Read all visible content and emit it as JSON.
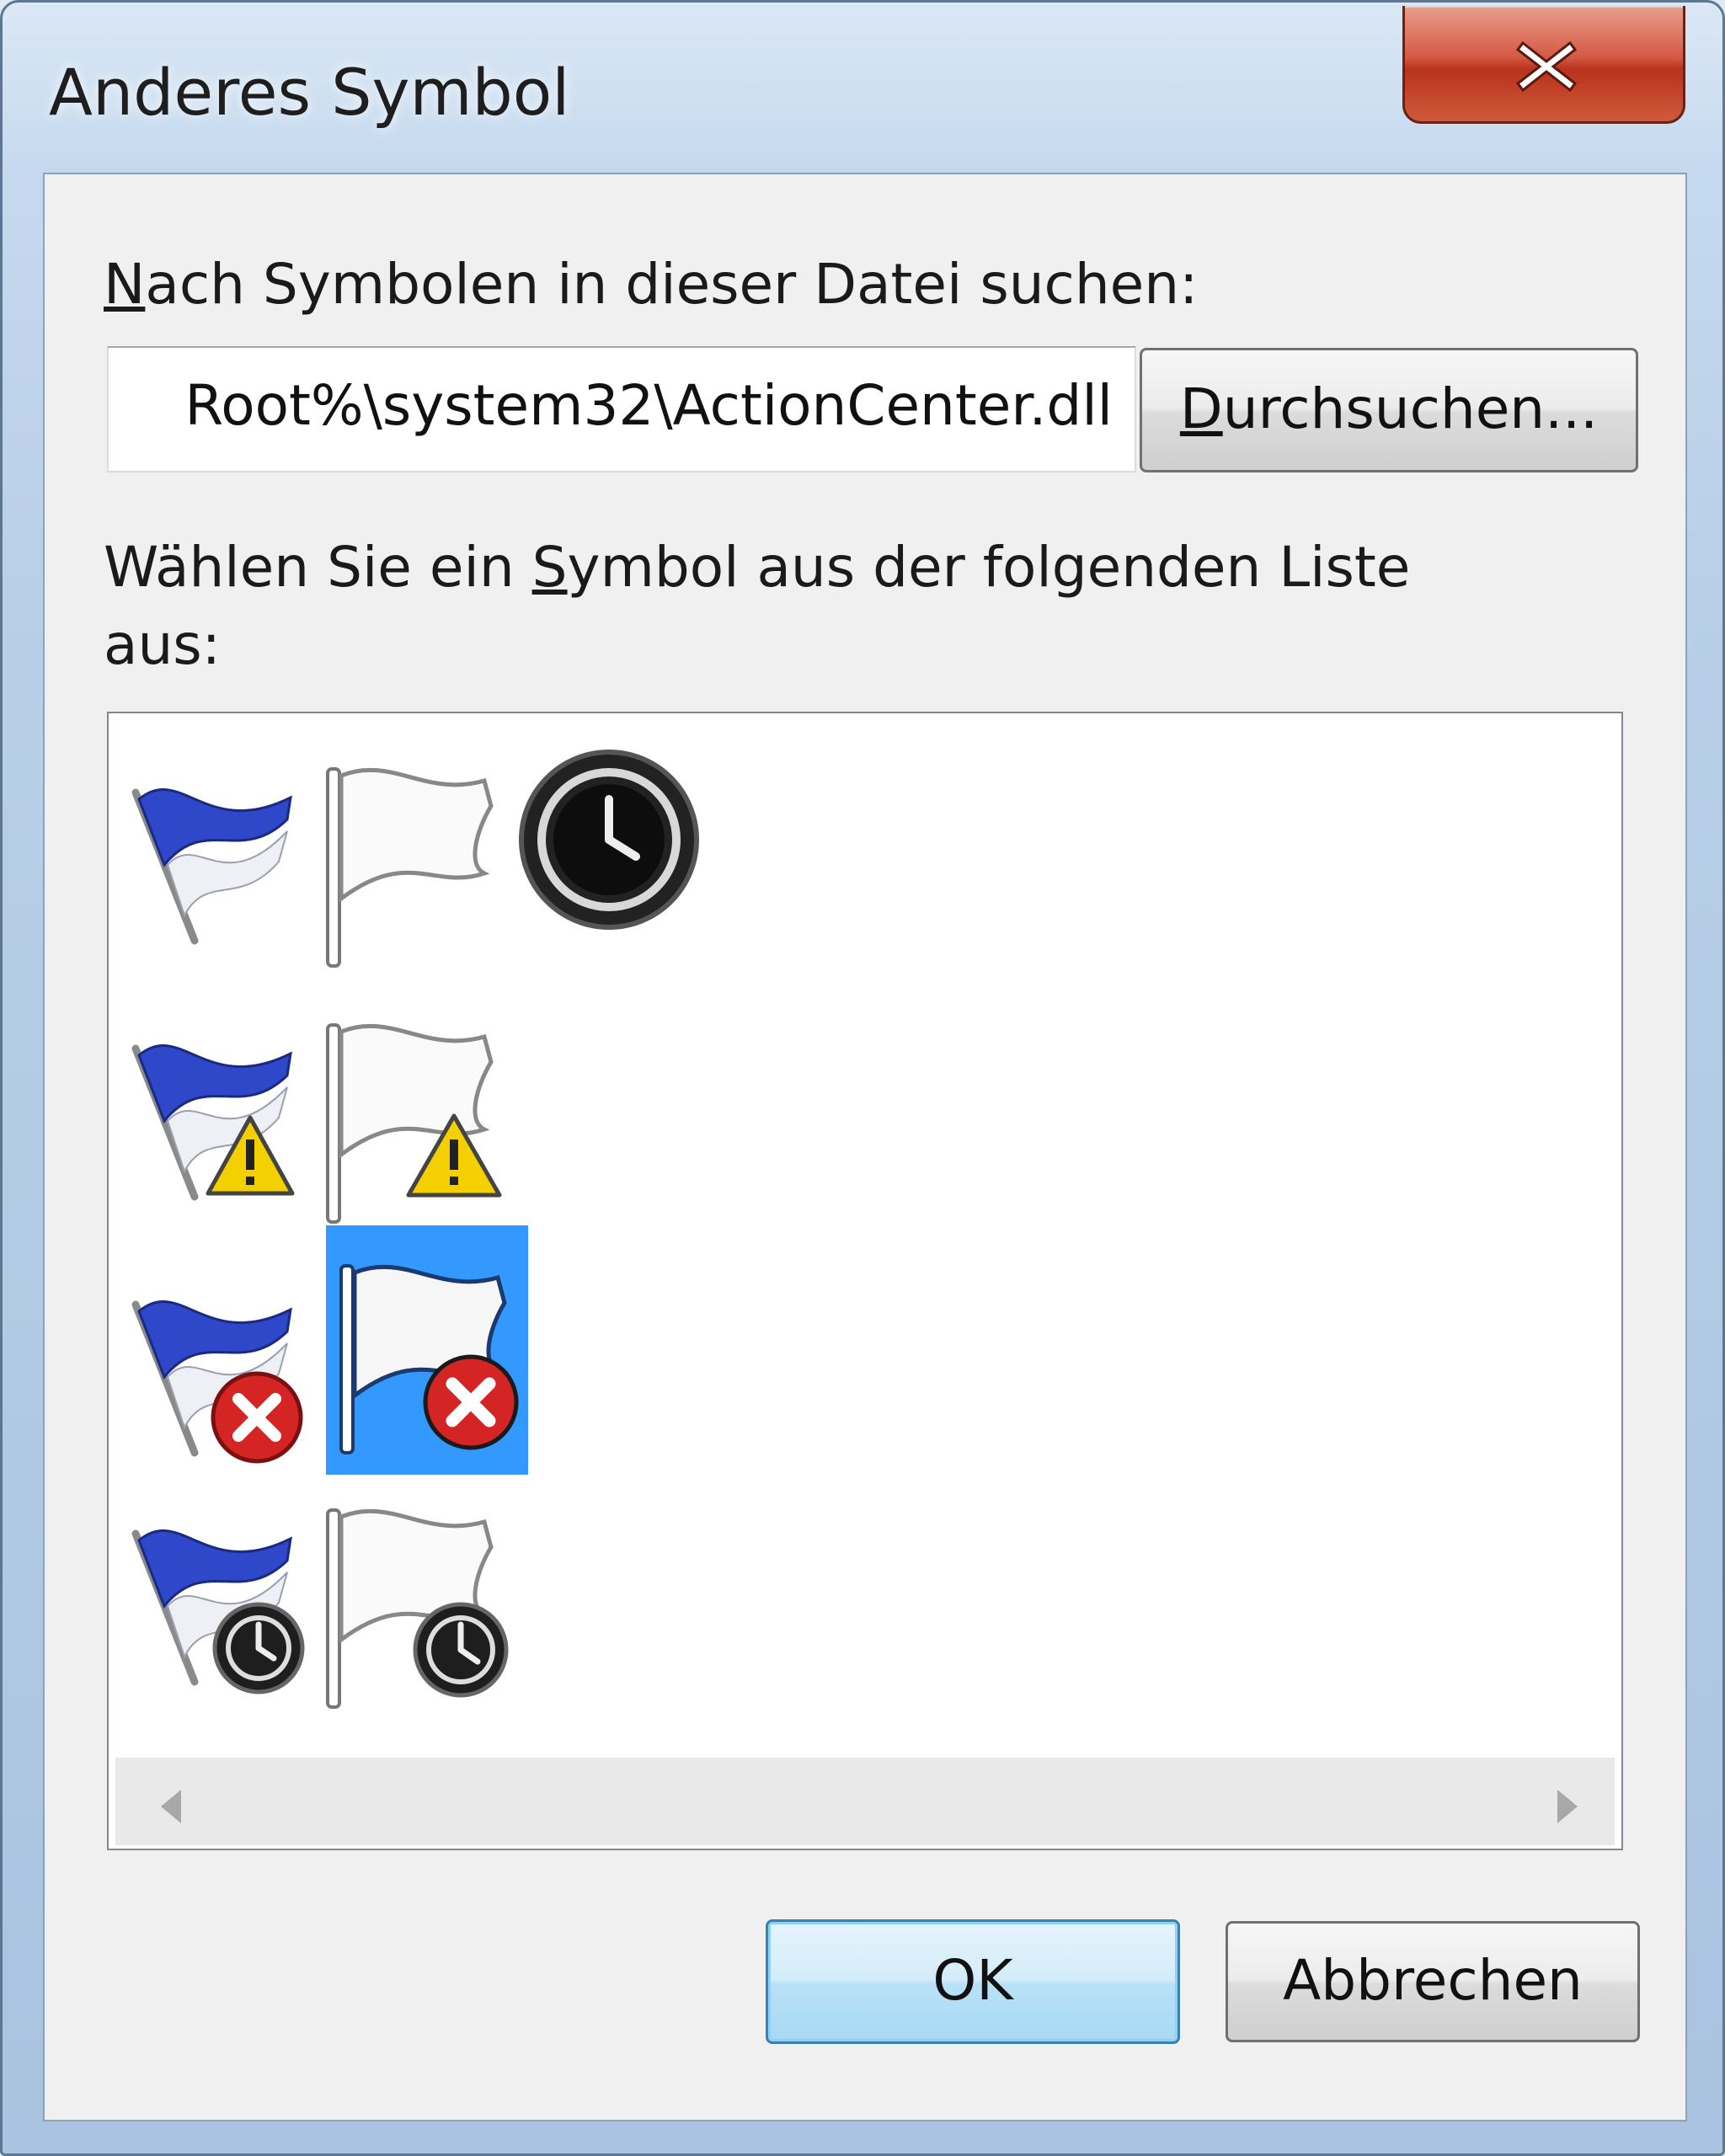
{
  "window": {
    "title": "Anderes Symbol"
  },
  "dialog": {
    "file_label_accel": "N",
    "file_label_rest": "ach Symbolen in dieser Datei suchen:",
    "file_path": "Root%\\system32\\ActionCenter.dll",
    "browse_accel": "D",
    "browse_rest": "urchsuchen...",
    "list_label_line1_pre": "Wählen Sie ein ",
    "list_label_line1_accel": "S",
    "list_label_line1_post": "ymbol aus der folgenden Liste",
    "list_label_line2": "aus:",
    "ok_label": "OK",
    "cancel_label": "Abbrechen"
  },
  "icons": [
    {
      "name": "blue-flag-icon",
      "selected": false
    },
    {
      "name": "white-flag-icon",
      "selected": false
    },
    {
      "name": "clock-icon",
      "selected": false
    },
    {
      "name": "blue-flag-warning-icon",
      "selected": false
    },
    {
      "name": "white-flag-warning-icon",
      "selected": false
    },
    {
      "name": "blue-flag-error-icon",
      "selected": false
    },
    {
      "name": "white-flag-error-icon",
      "selected": true
    },
    {
      "name": "blue-flag-clock-icon",
      "selected": false
    },
    {
      "name": "white-flag-clock-icon",
      "selected": false
    }
  ],
  "colors": {
    "selection": "#3399ff",
    "blue_flag": "#2f47c9",
    "warning": "#f5d000",
    "error": "#d42424"
  }
}
